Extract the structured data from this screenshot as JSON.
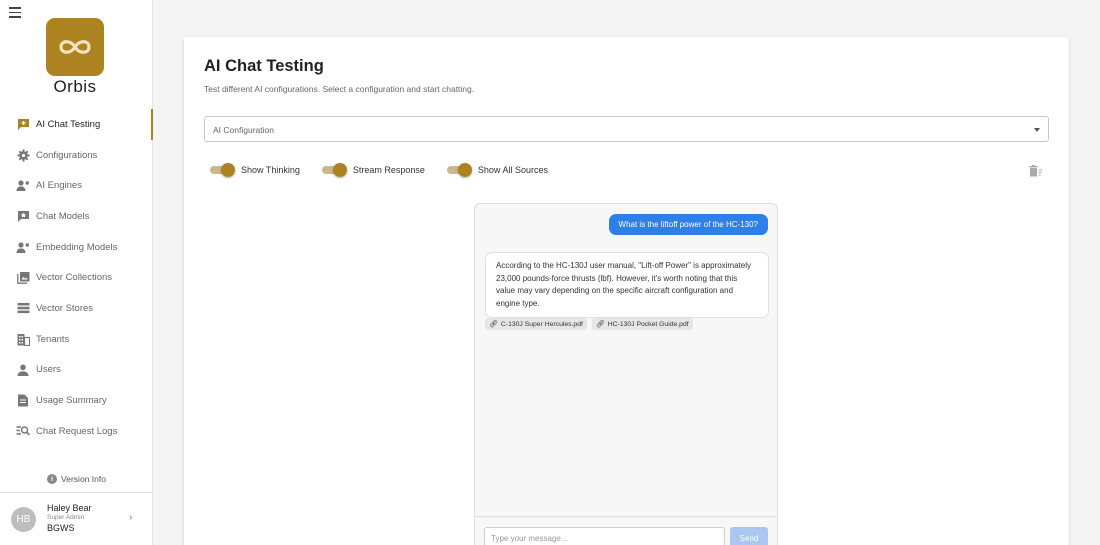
{
  "app": {
    "logo_name": "Orbis",
    "accent": "#ad8221"
  },
  "sidebar": {
    "items": [
      {
        "label": "AI Chat Testing",
        "icon": "chat-plus-icon",
        "active": true
      },
      {
        "label": "Configurations",
        "icon": "gear-icon"
      },
      {
        "label": "AI Engines",
        "icon": "user-gear-icon"
      },
      {
        "label": "Chat Models",
        "icon": "chat-star-icon"
      },
      {
        "label": "Embedding Models",
        "icon": "user-gear-icon"
      },
      {
        "label": "Vector Collections",
        "icon": "collections-icon"
      },
      {
        "label": "Vector Stores",
        "icon": "list-icon"
      },
      {
        "label": "Tenants",
        "icon": "building-icon"
      },
      {
        "label": "Users",
        "icon": "person-icon"
      },
      {
        "label": "Usage Summary",
        "icon": "document-icon"
      },
      {
        "label": "Chat Request Logs",
        "icon": "search-list-icon"
      }
    ],
    "version_label": "Version Info",
    "user": {
      "initials": "HB",
      "name": "Haley Bear",
      "role": "Super Admin",
      "org": "BGWS"
    }
  },
  "page": {
    "title": "AI Chat Testing",
    "subtitle": "Test different AI configurations. Select a configuration and start chatting.",
    "config_select_label": "AI Configuration",
    "toggles": [
      {
        "label": "Show Thinking",
        "on": true
      },
      {
        "label": "Stream Response",
        "on": true
      },
      {
        "label": "Show All Sources",
        "on": true
      }
    ]
  },
  "chat": {
    "user_message": "What is the liftoff power of the HC-130?",
    "bot_message": "According to the HC-130J user manual, \"Lift-off Power\" is approximately 23,000 pounds-force thrusts (lbf). However, it's worth noting that this value may vary depending on the specific aircraft configuration and engine type.",
    "sources": [
      "C-130J Super Hercules.pdf",
      "HC-130J Pocket Guide.pdf"
    ],
    "input_placeholder": "Type your message...",
    "send_label": "Send"
  }
}
